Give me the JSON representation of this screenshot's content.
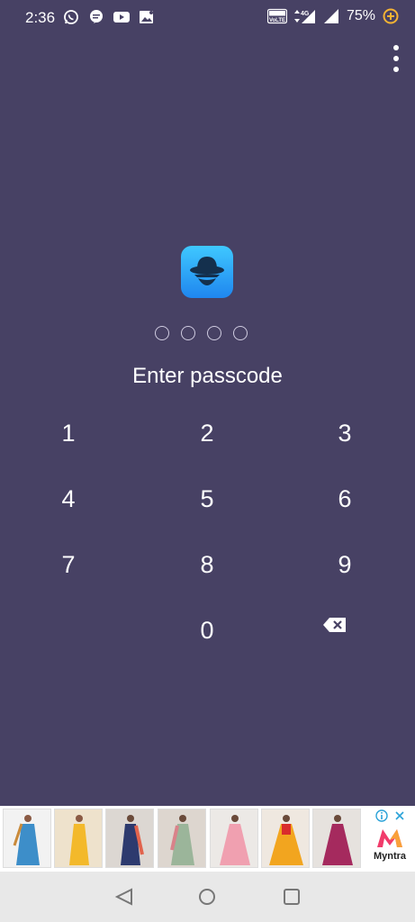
{
  "status_bar": {
    "time": "2:36",
    "battery": "75%",
    "network_label_1": "VoLTE",
    "network_label_2": "4G",
    "left_icons": [
      "whatsapp-icon",
      "message-icon",
      "youtube-icon",
      "gallery-icon"
    ],
    "right_icons": [
      "volte-icon",
      "data-arrows-icon",
      "signal-icon",
      "signal-icon",
      "battery-saver-icon"
    ]
  },
  "lock_screen": {
    "prompt": "Enter passcode",
    "passcode_length": 4,
    "keypad": {
      "k1": "1",
      "k2": "2",
      "k3": "3",
      "k4": "4",
      "k5": "5",
      "k6": "6",
      "k7": "7",
      "k8": "8",
      "k9": "9",
      "k0": "0"
    },
    "backspace_icon": "backspace-icon",
    "app_icon": "incognito-hat-icon"
  },
  "ad_banner": {
    "brand": "Myntra",
    "thumbnail_count": 7,
    "adchoice_icons": [
      "info-icon",
      "close-icon"
    ]
  },
  "nav_bar": {
    "buttons": [
      "back-icon",
      "home-icon",
      "recents-icon"
    ]
  },
  "colors": {
    "background": "#474164",
    "app_icon_top": "#3fc8ff",
    "app_icon_bottom": "#1f86ef",
    "nav_bar": "#e8e8e8",
    "ad_background": "#ffffff",
    "myntra_orange": "#f13b6b"
  }
}
